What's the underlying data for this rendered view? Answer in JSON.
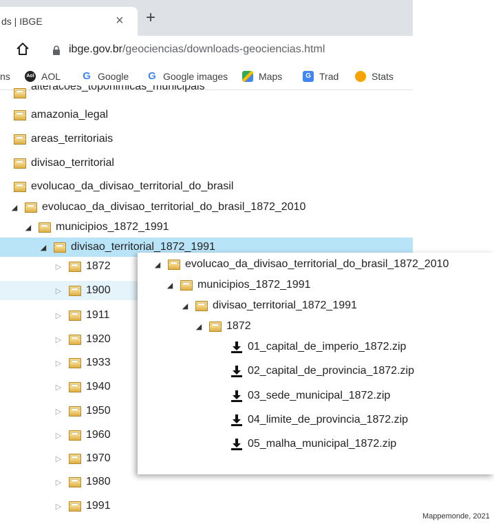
{
  "browser": {
    "tab_title": "ds | IBGE",
    "tab_close": "×",
    "new_tab": "+",
    "url_host": "ibge.gov.br",
    "url_path": "/geociencias/downloads-geociencias.html"
  },
  "bookmarks": [
    {
      "label": "ns",
      "icon": "apps-icon"
    },
    {
      "label": "AOL",
      "icon": "aol-icon"
    },
    {
      "label": "Google",
      "icon": "google-icon"
    },
    {
      "label": "Google images",
      "icon": "google-icon"
    },
    {
      "label": "Maps",
      "icon": "maps-icon"
    },
    {
      "label": "Trad",
      "icon": "translate-icon"
    },
    {
      "label": "Stats",
      "icon": "stats-icon"
    }
  ],
  "tree": {
    "partial_top": "alteracoes_toponimicas_municipais",
    "items": [
      "amazonia_legal",
      "areas_territoriais",
      "divisao_territorial",
      "evolucao_da_divisao_territorial_do_brasil",
      "evolucao_da_divisao_territorial_do_brasil_1872_2010",
      "municipios_1872_1991",
      "divisao_territorial_1872_1991"
    ],
    "years": [
      "1872",
      "1900",
      "1911",
      "1920",
      "1933",
      "1940",
      "1950",
      "1960",
      "1970",
      "1980",
      "1991"
    ]
  },
  "overlay": {
    "folders": [
      "evolucao_da_divisao_territorial_do_brasil_1872_2010",
      "municipios_1872_1991",
      "divisao_territorial_1872_1991",
      "1872"
    ],
    "files": [
      "01_capital_de_imperio_1872.zip",
      "02_capital_de_provincia_1872.zip",
      "03_sede_municipal_1872.zip",
      "04_limite_de_provincia_1872.zip",
      "05_malha_municipal_1872.zip"
    ]
  },
  "credit": "Mappemonde, 2021"
}
